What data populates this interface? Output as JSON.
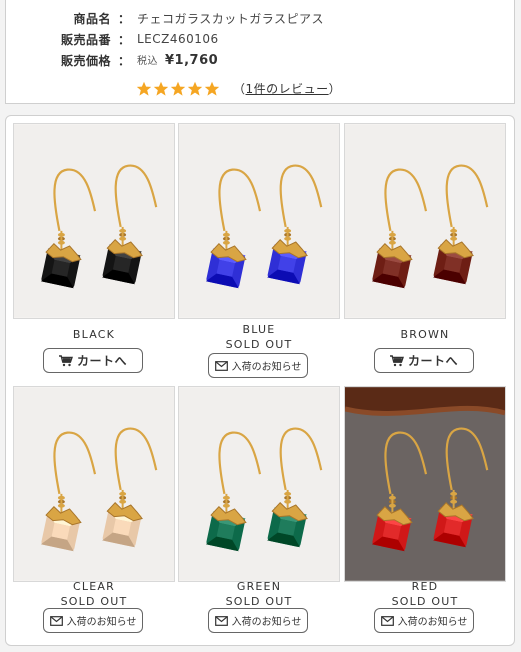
{
  "product": {
    "name_label": "商品名",
    "name": "チェコガラスカットガラスピアス",
    "code_label": "販売品番",
    "code": "LECZ460106",
    "price_label": "販売価格",
    "tax_label": "税込",
    "price": "¥1,760",
    "rating": 5,
    "review_open": "（",
    "review_link": "1件のレビュー",
    "review_close": "）",
    "colon": "："
  },
  "buttons": {
    "cart": "カートへ",
    "notify": "入荷のお知らせ"
  },
  "colors": {
    "star": "#f5a623",
    "border": "#cfcfcf"
  },
  "variants": [
    {
      "name": "BLACK",
      "status": "",
      "action": "cart",
      "gem": "#141414"
    },
    {
      "name": "BLUE",
      "status": "SOLD OUT",
      "action": "notify",
      "gem": "#2f2fd6"
    },
    {
      "name": "BROWN",
      "status": "",
      "action": "cart",
      "gem": "#6e1e14"
    },
    {
      "name": "CLEAR",
      "status": "SOLD OUT",
      "action": "notify",
      "gem": "#e8c8a8"
    },
    {
      "name": "GREEN",
      "status": "SOLD OUT",
      "action": "notify",
      "gem": "#0d6a4a"
    },
    {
      "name": "RED",
      "status": "SOLD OUT",
      "action": "notify",
      "gem": "#d01818"
    }
  ]
}
